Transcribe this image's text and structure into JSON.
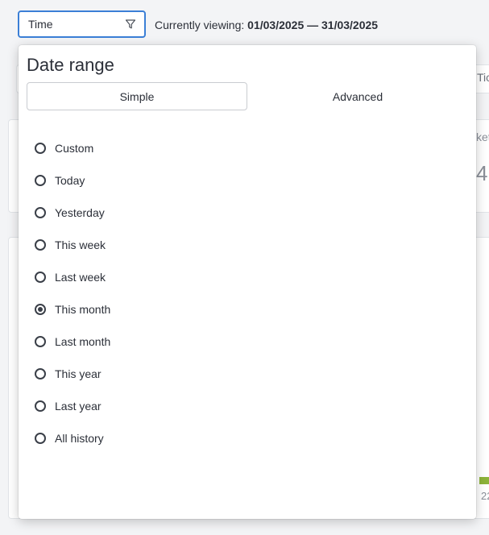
{
  "filter": {
    "label": "Time",
    "icon": "filter-icon"
  },
  "viewing": {
    "prefix": "Currently viewing:",
    "range": "01/03/2025 — 31/03/2025"
  },
  "date_range": {
    "title": "Date range",
    "tabs": [
      {
        "label": "Simple",
        "active": true
      },
      {
        "label": "Advanced",
        "active": false
      }
    ],
    "options": [
      {
        "label": "Custom",
        "selected": false
      },
      {
        "label": "Today",
        "selected": false
      },
      {
        "label": "Yesterday",
        "selected": false
      },
      {
        "label": "This week",
        "selected": false
      },
      {
        "label": "Last week",
        "selected": false
      },
      {
        "label": "This month",
        "selected": true
      },
      {
        "label": "Last month",
        "selected": false
      },
      {
        "label": "This year",
        "selected": false
      },
      {
        "label": "Last year",
        "selected": false
      },
      {
        "label": "All history",
        "selected": false
      }
    ]
  },
  "background": {
    "tab_fragment": "Tic",
    "card_label_fragment": "ket",
    "card_value_fragment": "4",
    "axis_fragment": "22"
  },
  "colors": {
    "focus_border": "#3b7fd6",
    "bar": "#8db33a"
  }
}
